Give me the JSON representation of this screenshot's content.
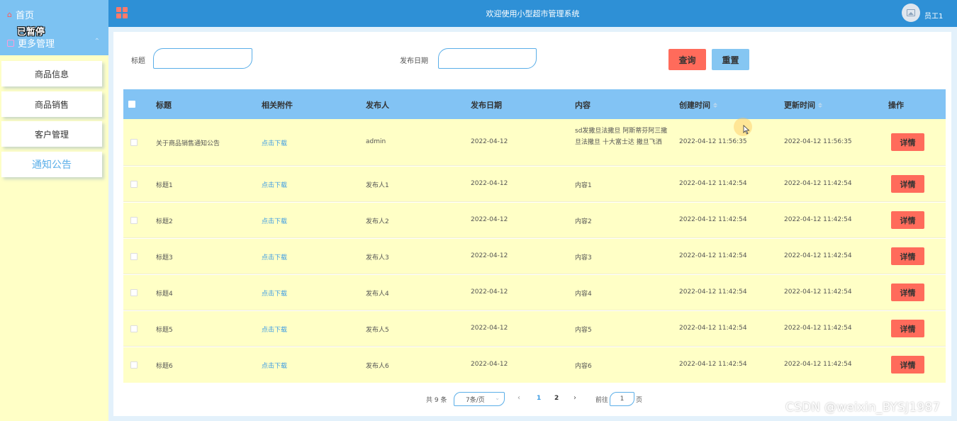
{
  "sidebar": {
    "home_label": "首页",
    "paused_label": "已暂停",
    "more_label": "更多管理",
    "items": [
      {
        "label": "商品信息",
        "active": false
      },
      {
        "label": "商品销售",
        "active": false
      },
      {
        "label": "客户管理",
        "active": false
      },
      {
        "label": "通知公告",
        "active": true
      }
    ]
  },
  "header": {
    "title": "欢迎使用小型超市管理系统",
    "username": "员工1"
  },
  "search": {
    "title_label": "标题",
    "title_value": "",
    "date_label": "发布日期",
    "date_value": "",
    "query_label": "查询",
    "reset_label": "重置"
  },
  "table": {
    "columns": {
      "title": "标题",
      "attachment": "相关附件",
      "publisher": "发布人",
      "publish_date": "发布日期",
      "content": "内容",
      "created": "创建时间",
      "updated": "更新时间",
      "action": "操作"
    },
    "rows": [
      {
        "title": "关于商品销售通知公告",
        "attachment": "点击下载",
        "publisher": "admin",
        "publish_date": "2022-04-12",
        "content": "sd发撒旦法撒旦 阿斯蒂芬阿三撒旦法撒旦 十大富士达 撒旦飞洒",
        "created": "2022-04-12 11:56:35",
        "updated": "2022-04-12 11:56:35",
        "action": "详情"
      },
      {
        "title": "标题1",
        "attachment": "点击下载",
        "publisher": "发布人1",
        "publish_date": "2022-04-12",
        "content": "内容1",
        "created": "2022-04-12 11:42:54",
        "updated": "2022-04-12 11:42:54",
        "action": "详情"
      },
      {
        "title": "标题2",
        "attachment": "点击下载",
        "publisher": "发布人2",
        "publish_date": "2022-04-12",
        "content": "内容2",
        "created": "2022-04-12 11:42:54",
        "updated": "2022-04-12 11:42:54",
        "action": "详情"
      },
      {
        "title": "标题3",
        "attachment": "点击下载",
        "publisher": "发布人3",
        "publish_date": "2022-04-12",
        "content": "内容3",
        "created": "2022-04-12 11:42:54",
        "updated": "2022-04-12 11:42:54",
        "action": "详情"
      },
      {
        "title": "标题4",
        "attachment": "点击下载",
        "publisher": "发布人4",
        "publish_date": "2022-04-12",
        "content": "内容4",
        "created": "2022-04-12 11:42:54",
        "updated": "2022-04-12 11:42:54",
        "action": "详情"
      },
      {
        "title": "标题5",
        "attachment": "点击下载",
        "publisher": "发布人5",
        "publish_date": "2022-04-12",
        "content": "内容5",
        "created": "2022-04-12 11:42:54",
        "updated": "2022-04-12 11:42:54",
        "action": "详情"
      },
      {
        "title": "标题6",
        "attachment": "点击下载",
        "publisher": "发布人6",
        "publish_date": "2022-04-12",
        "content": "内容6",
        "created": "2022-04-12 11:42:54",
        "updated": "2022-04-12 11:42:54",
        "action": "详情"
      }
    ]
  },
  "pagination": {
    "total_text": "共 9 条",
    "page_size": "7条/页",
    "pages": [
      "1",
      "2"
    ],
    "current_page": "1",
    "goto_label": "前往",
    "goto_value": "1",
    "page_unit": "页"
  },
  "watermark": "CSDN @weixin_BYSJ1987",
  "colors": {
    "header": "#2e90d6",
    "sidebar_top": "#7cc2f2",
    "sidebar_bg": "#ffffc6",
    "table_header": "#82c3f4",
    "row_bg": "#ffffc6",
    "danger_button": "#ff6b5b",
    "reset_button": "#85c6f2",
    "link": "#3c9be3"
  },
  "icons": {
    "home": "home-icon",
    "more": "menu-box-icon",
    "header_menu": "grid-icon",
    "avatar": "image-icon",
    "sort": "sort-icon"
  }
}
